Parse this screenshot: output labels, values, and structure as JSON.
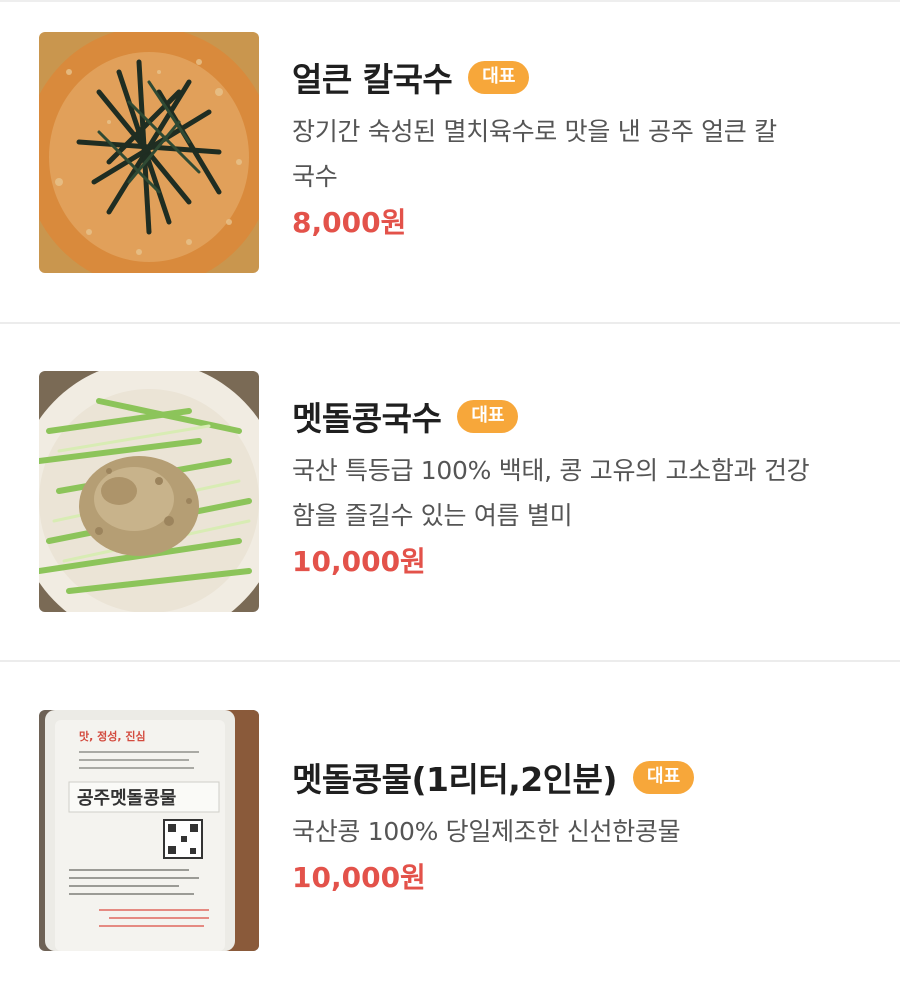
{
  "menu": {
    "items": [
      {
        "name": "얼큰 칼국수",
        "badge": "대표",
        "description_line1": "장기간 숙성된 멸치육수로 맛을 낸 공주 얼큰 칼",
        "description_line2": "국수",
        "price": "8,000원",
        "image_icon": "spicy-noodle-photo"
      },
      {
        "name": "멧돌콩국수",
        "badge": "대표",
        "description_line1": "국산 특등급 100% 백태, 콩 고유의 고소함과 건강",
        "description_line2": "함을 즐길수 있는 여름 별미",
        "price": "10,000원",
        "image_icon": "soy-noodle-photo"
      },
      {
        "name": "멧돌콩물(1리터,2인분)",
        "badge": "대표",
        "description_line1": "국산콩 100% 당일제조한 신선한콩물",
        "price": "10,000원",
        "image_icon": "soy-milk-bottle-photo"
      }
    ]
  },
  "colors": {
    "badge_bg": "#f7a73a",
    "price": "#e3524a",
    "divider": "#ececec"
  },
  "bottle_label": {
    "top_line": "맛, 정성, 진심",
    "title": "공주멧돌콩물"
  }
}
